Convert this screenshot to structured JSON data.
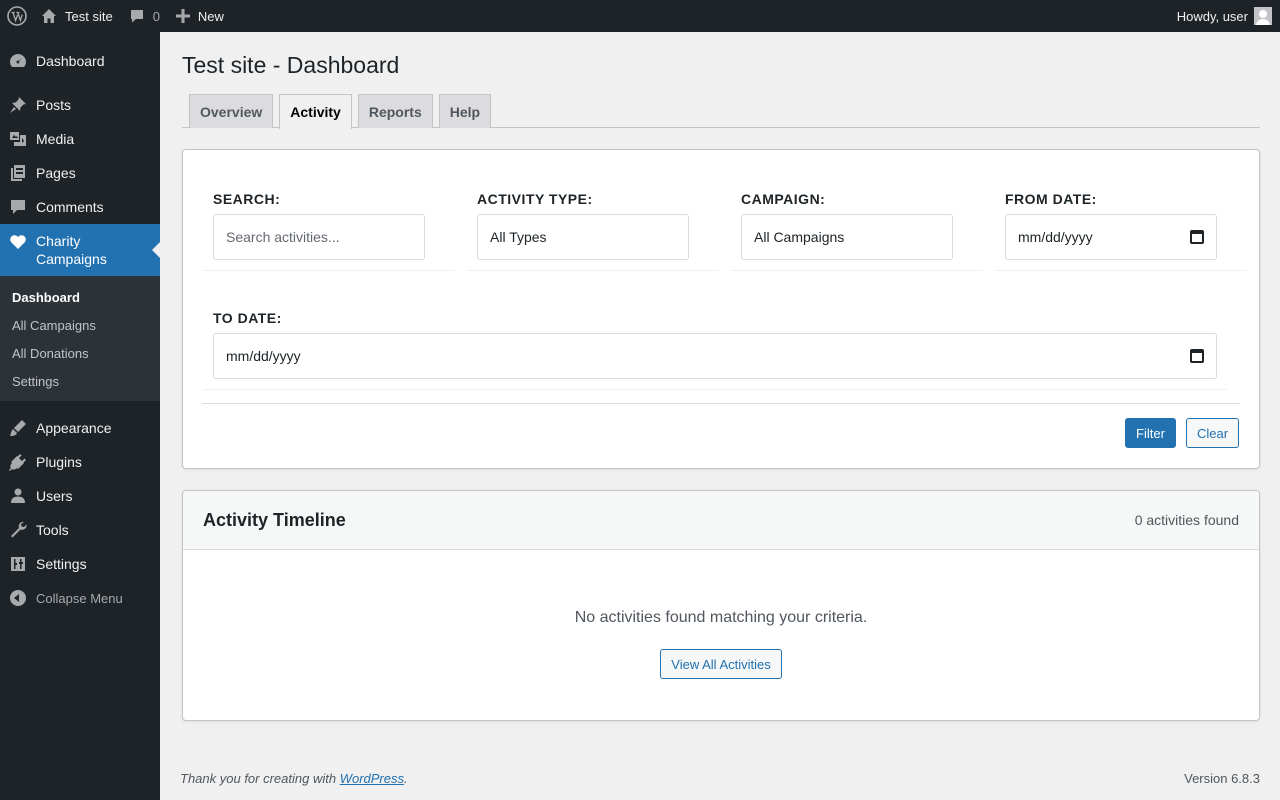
{
  "admin_bar": {
    "site_name": "Test site",
    "comments_count": "0",
    "new_label": "New",
    "greeting": "Howdy, user"
  },
  "sidebar": {
    "items_top": [
      {
        "label": "Dashboard",
        "icon": "dashboard-icon"
      },
      {
        "label": "Posts",
        "icon": "pin-icon"
      },
      {
        "label": "Media",
        "icon": "media-icon"
      },
      {
        "label": "Pages",
        "icon": "pages-icon"
      },
      {
        "label": "Comments",
        "icon": "comment-icon"
      }
    ],
    "current": {
      "label": "Charity Campaigns",
      "icon": "heart-icon"
    },
    "submenu": [
      "Dashboard",
      "All Campaigns",
      "All Donations",
      "Settings"
    ],
    "items_bottom": [
      {
        "label": "Appearance",
        "icon": "brush-icon"
      },
      {
        "label": "Plugins",
        "icon": "plug-icon"
      },
      {
        "label": "Users",
        "icon": "user-icon"
      },
      {
        "label": "Tools",
        "icon": "wrench-icon"
      },
      {
        "label": "Settings",
        "icon": "sliders-icon"
      }
    ],
    "collapse_label": "Collapse Menu"
  },
  "page": {
    "title": "Test site - Dashboard",
    "tabs": [
      "Overview",
      "Activity",
      "Reports",
      "Help"
    ],
    "active_tab": "Activity"
  },
  "filters": {
    "search_label": "SEARCH:",
    "search_placeholder": "Search activities...",
    "type_label": "ACTIVITY TYPE:",
    "type_value": "All Types",
    "campaign_label": "CAMPAIGN:",
    "campaign_value": "All Campaigns",
    "from_label": "FROM DATE:",
    "from_value": "mm/dd/yyyy",
    "to_label": "TO DATE:",
    "to_value": "mm/dd/yyyy",
    "filter_button": "Filter",
    "clear_button": "Clear"
  },
  "timeline": {
    "title": "Activity Timeline",
    "count": "0 activities found",
    "empty_message": "No activities found matching your criteria.",
    "view_all": "View All Activities"
  },
  "footer": {
    "thanks_prefix": "Thank you for creating with ",
    "link": "WordPress",
    "thanks_suffix": ".",
    "version": "Version 6.8.3"
  }
}
